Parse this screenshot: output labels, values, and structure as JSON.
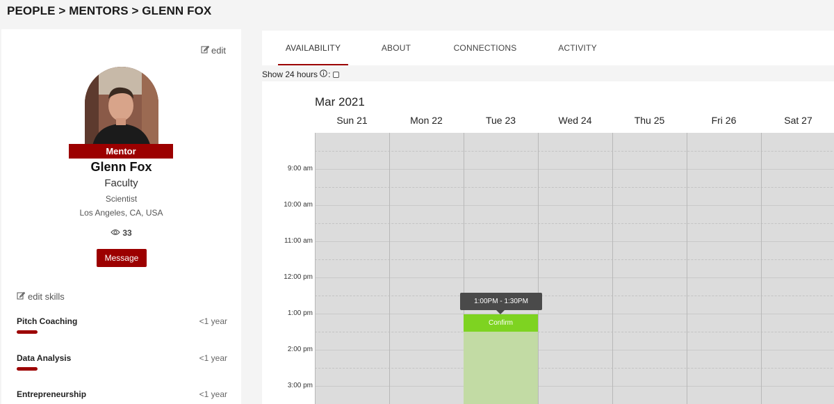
{
  "breadcrumb": "PEOPLE > MENTORS > GLENN FOX",
  "profile": {
    "edit_label": "edit",
    "role_badge": "Mentor",
    "name": "Glenn Fox",
    "title": "Faculty",
    "subtitle": "Scientist",
    "location": "Los Angeles, CA, USA",
    "views": "33",
    "message_label": "Message",
    "edit_skills_label": "edit skills",
    "skills": [
      {
        "name": "Pitch Coaching",
        "duration": "<1 year"
      },
      {
        "name": "Data Analysis",
        "duration": "<1 year"
      },
      {
        "name": "Entrepreneurship",
        "duration": "<1 year"
      }
    ],
    "accent_color": "#9c0000"
  },
  "tabs": [
    {
      "label": "AVAILABILITY",
      "active": true
    },
    {
      "label": "ABOUT",
      "active": false
    },
    {
      "label": "CONNECTIONS",
      "active": false
    },
    {
      "label": "ACTIVITY",
      "active": false
    }
  ],
  "calendar": {
    "show24_label": "Show 24 hours",
    "show24_checked": false,
    "month": "Mar 2021",
    "days": [
      "Sun 21",
      "Mon 22",
      "Tue 23",
      "Wed 24",
      "Thu 25",
      "Fri 26",
      "Sat 27"
    ],
    "times": [
      "9:00 am",
      "10:00 am",
      "11:00 am",
      "12:00 pm",
      "1:00 pm",
      "2:00 pm",
      "3:00 pm"
    ],
    "tooltip": "1:00PM - 1:30PM",
    "confirm_label": "Confirm",
    "confirm_color": "#7ed321",
    "slot_color": "#c2dba4"
  }
}
